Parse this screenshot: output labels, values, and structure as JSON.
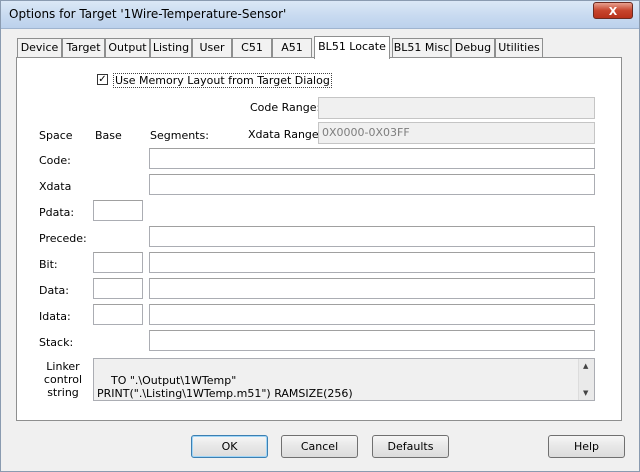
{
  "window": {
    "title": "Options for Target '1Wire-Temperature-Sensor'",
    "close_label": "X"
  },
  "tabs": [
    {
      "label": "Device"
    },
    {
      "label": "Target"
    },
    {
      "label": "Output"
    },
    {
      "label": "Listing"
    },
    {
      "label": "User"
    },
    {
      "label": "C51"
    },
    {
      "label": "A51"
    },
    {
      "label": "BL51 Locate"
    },
    {
      "label": "BL51 Misc"
    },
    {
      "label": "Debug"
    },
    {
      "label": "Utilities"
    }
  ],
  "active_tab": "BL51 Locate",
  "use_memory_layout": {
    "label": "Use Memory Layout from Target Dialog",
    "checked": true
  },
  "code_range": {
    "label": "Code Range:",
    "value": ""
  },
  "xdata_range": {
    "label": "Xdata Range:",
    "value": "0X0000-0X03FF"
  },
  "headers": {
    "space": "Space",
    "base": "Base",
    "segments": "Segments:"
  },
  "rows": {
    "code": {
      "label": "Code:",
      "base": "",
      "segments": ""
    },
    "xdata": {
      "label": "Xdata",
      "base": "",
      "segments": ""
    },
    "pdata": {
      "label": "Pdata:",
      "base": "",
      "segments": ""
    },
    "precede": {
      "label": "Precede:",
      "segments": ""
    },
    "bit": {
      "label": "Bit:",
      "base": "",
      "segments": ""
    },
    "data": {
      "label": "Data:",
      "base": "",
      "segments": ""
    },
    "idata": {
      "label": "Idata:",
      "base": "",
      "segments": ""
    },
    "stack": {
      "label": "Stack:",
      "segments": ""
    }
  },
  "linker": {
    "label_line1": "Linker",
    "label_line2": "control",
    "label_line3": "string",
    "text": "TO \".\\Output\\1WTemp\"\nPRINT(\".\\Listing\\1WTemp.m51\") RAMSIZE(256)"
  },
  "buttons": {
    "ok": "OK",
    "cancel": "Cancel",
    "defaults": "Defaults",
    "help": "Help"
  }
}
